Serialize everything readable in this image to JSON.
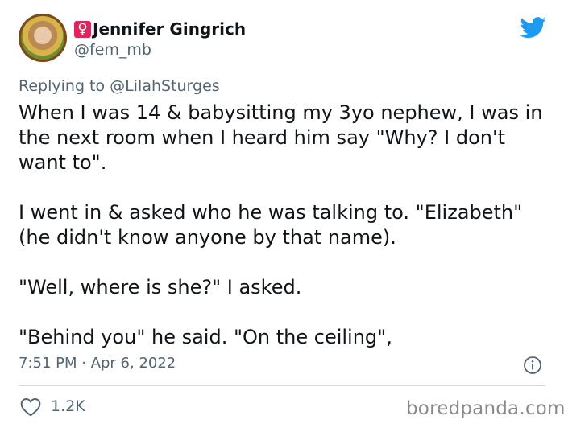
{
  "author": {
    "name": "Jennifer Gingrich",
    "name_prefix_symbol": "♀",
    "handle": "@fem_mb",
    "avatar_icon": "profile-photo"
  },
  "reply": {
    "prefix": "Replying to",
    "to": "@LilahSturges"
  },
  "tweet": {
    "paragraphs": [
      "When I was 14 & babysitting my 3yo nephew, I was in the next room when I heard him say \"Why? I don't want to\".",
      "I went in & asked who he was talking to. \"Elizabeth\"(he didn't know anyone by that name).",
      "\"Well, where is she?\" I asked.",
      "\"Behind you\" he said. \"On the ceiling\","
    ],
    "timestamp": "7:51 PM · Apr 6, 2022"
  },
  "engagement": {
    "likes": "1.2K"
  },
  "watermark": "boredpanda.com",
  "colors": {
    "twitter_blue": "#1d9bf0",
    "muted_text": "#536471",
    "female_badge": "#e0245e"
  }
}
